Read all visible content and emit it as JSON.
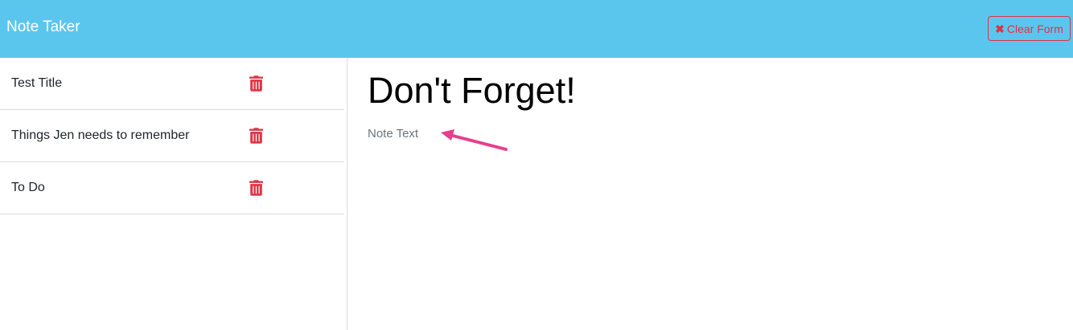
{
  "navbar": {
    "brand": "Note Taker",
    "clear_button_label": "Clear Form",
    "background_color": "#5bc6ed"
  },
  "sidebar": {
    "items": [
      {
        "title": "Test Title",
        "delete_icon": "trash-icon"
      },
      {
        "title": "Things Jen needs to remember",
        "delete_icon": "trash-icon"
      },
      {
        "title": "To Do",
        "delete_icon": "trash-icon"
      }
    ]
  },
  "main": {
    "note_title": "Don't Forget!",
    "note_text_placeholder": "Note Text"
  },
  "colors": {
    "accent_danger": "#dc3545",
    "annotation_arrow": "#e83e8c"
  }
}
